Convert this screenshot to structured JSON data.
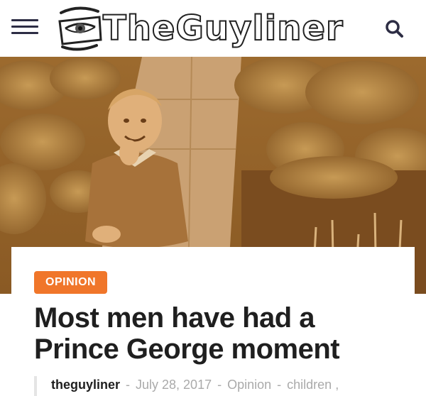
{
  "header": {
    "site_name": "TheGuyliner",
    "menu_icon": "hamburger-menu-icon",
    "search_icon": "search-icon",
    "logo_icon": "eyeliner-eye-logo-icon"
  },
  "hero": {
    "image_description": "sepia-toned photo of a smiling young boy in a sweater crouching on a garden path with hosta leaves"
  },
  "article": {
    "category": "OPINION",
    "title": "Most men have had a Prince George moment",
    "author": "theguyliner",
    "date": "July 28, 2017",
    "category_link": "Opinion",
    "tag": "children",
    "tag_suffix": ",",
    "separator": "-"
  },
  "colors": {
    "accent": "#f0762a",
    "text": "#1f1f1f",
    "muted": "#aaaaaa",
    "sepia": "#b8743a"
  }
}
